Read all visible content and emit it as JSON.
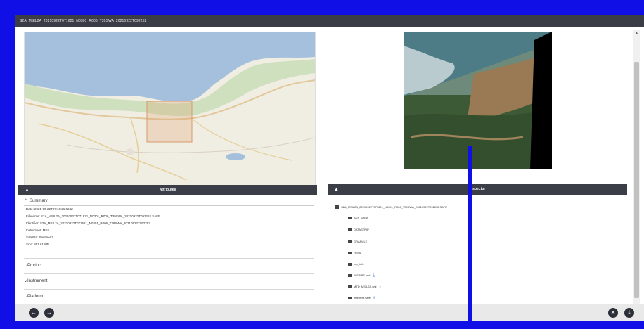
{
  "window": {
    "title": "S2A_MSIL2A_20210922T071621_N0301_R006_T39SWA_20210922T092252"
  },
  "attributes": {
    "header": "Attributes",
    "summary": {
      "label": "Summary",
      "date": "Date: 2021-09-22T07:16:21.024Z",
      "filename": "Filename: S2A_MSIL2A_20210922T071621_N0301_R006_T39SWA_20210922T092252.SAFE",
      "identifier": "Identifier: S2A_MSIL2A_20210922T071621_N0301_R006_T39SWA_20210922T092252",
      "instrument": "Instrument: MSI",
      "satellite": "Satellite: Sentinel-2",
      "size": "Size: 881.61 MB"
    },
    "sections": [
      "Product",
      "Instrument",
      "Platform"
    ]
  },
  "inspector": {
    "header": "Inspector",
    "root": "S2A_MSIL2A_20210922T071621_N0301_R006_T39SWA_20210922T092252.SAFE",
    "items": [
      {
        "label": "AUX_DATA",
        "download": false
      },
      {
        "label": "DATASTRIP",
        "download": false
      },
      {
        "label": "GRANULE",
        "download": false
      },
      {
        "label": "HTML",
        "download": false
      },
      {
        "label": "rep_info",
        "download": false
      },
      {
        "label": "INSPIRE.xml",
        "download": true
      },
      {
        "label": "MTD_MSIL2A.xml",
        "download": true
      },
      {
        "label": "manifest.safe",
        "download": true
      }
    ]
  },
  "icons": {
    "collapse": "chevron-up-icon",
    "expand": "chevron-down-icon",
    "prev": "arrow-left-icon",
    "next": "arrow-right-icon",
    "close": "close-icon",
    "download": "download-icon",
    "folder": "folder-icon",
    "file": "file-icon"
  },
  "colors": {
    "frame_bg": "#1010e6",
    "header_bg": "#3b3e47",
    "accent": "#3b6fc7"
  }
}
